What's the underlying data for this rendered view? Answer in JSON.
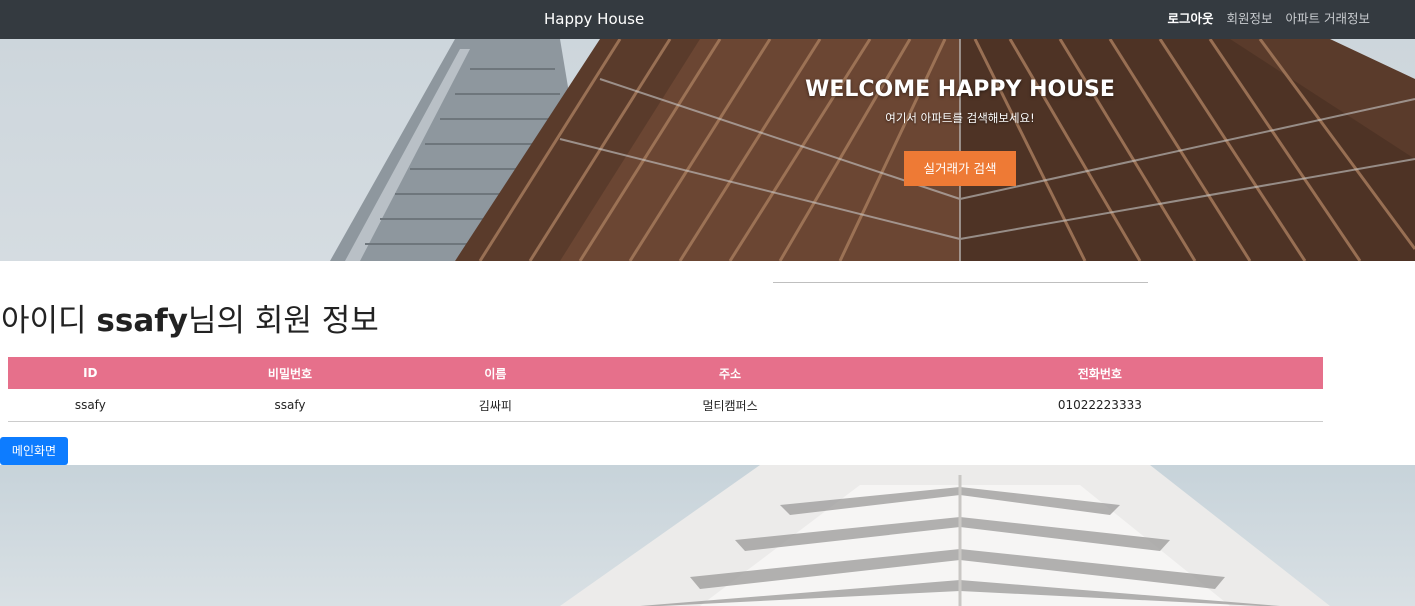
{
  "navbar": {
    "brand": "Happy House",
    "links": [
      {
        "label": "로그아웃"
      },
      {
        "label": "회원정보"
      },
      {
        "label": "아파트 거래정보"
      }
    ]
  },
  "hero": {
    "title": "WELCOME HAPPY HOUSE",
    "subtitle": "여기서 아파트를 검색해보세요!",
    "button_label": "실거래가 검색",
    "button_color": "#ee7a35"
  },
  "member": {
    "title_prefix": "아이디 ",
    "user_id": "ssafy",
    "title_suffix": "님의 회원 정보",
    "table": {
      "headers": [
        "ID",
        "비밀번호",
        "이름",
        "주소",
        "전화번호"
      ],
      "row": [
        "ssafy",
        "ssafy",
        "김싸피",
        "멀티캠퍼스",
        "01022223333"
      ],
      "header_color": "#e6708b"
    }
  },
  "actions": {
    "main_button_label": "메인화면",
    "main_button_color": "#0d7cff"
  }
}
